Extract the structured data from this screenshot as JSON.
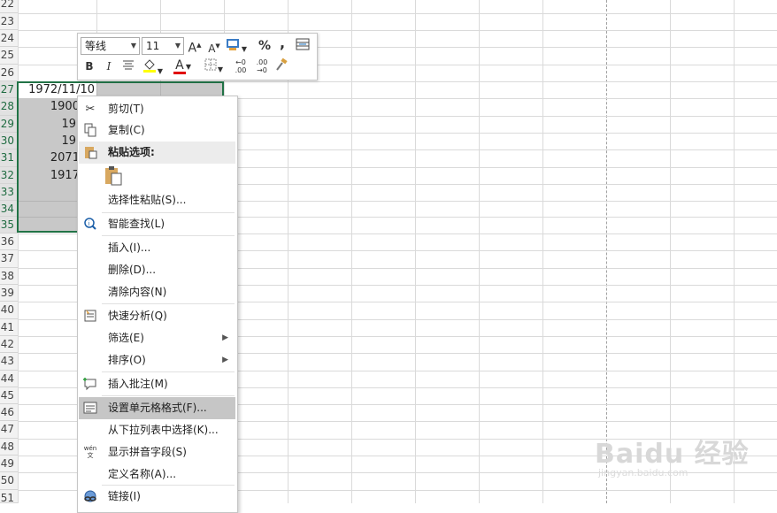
{
  "sheet": {
    "rows": [
      "22",
      "23",
      "24",
      "25",
      "26",
      "27",
      "28",
      "29",
      "30",
      "31",
      "32",
      "33",
      "34",
      "35",
      "36",
      "37",
      "38",
      "39",
      "40",
      "41",
      "42",
      "43",
      "44",
      "45",
      "46",
      "47",
      "48",
      "49",
      "50",
      "51"
    ],
    "cells": [
      "1972/11/10",
      "1900/1/",
      "1900/",
      "1900/",
      "2071/6/",
      "1917/2/"
    ]
  },
  "mini_toolbar": {
    "font_name": "等线",
    "font_size": "11",
    "grow_font": "A",
    "shrink_font": "A",
    "percent": "%",
    "comma": ",",
    "bold": "B",
    "italic": "I",
    "font_color_letter": "A",
    "dec_increase": "←0 .00",
    "dec_decrease": ".00 →0"
  },
  "context_menu": {
    "items": [
      {
        "label": "剪切(T)"
      },
      {
        "label": "复制(C)"
      },
      {
        "label": "粘贴选项:"
      },
      {
        "label": "选择性粘贴(S)..."
      },
      {
        "label": "智能查找(L)"
      },
      {
        "label": "插入(I)..."
      },
      {
        "label": "删除(D)..."
      },
      {
        "label": "清除内容(N)"
      },
      {
        "label": "快速分析(Q)"
      },
      {
        "label": "筛选(E)"
      },
      {
        "label": "排序(O)"
      },
      {
        "label": "插入批注(M)"
      },
      {
        "label": "设置单元格格式(F)..."
      },
      {
        "label": "从下拉列表中选择(K)..."
      },
      {
        "label": "显示拼音字段(S)"
      },
      {
        "label": "定义名称(A)..."
      },
      {
        "label": "链接(I)"
      }
    ],
    "pinyin_icon_text": "wén 文"
  },
  "watermark": {
    "brand": "Baidu 经验",
    "url": "jingyan.baidu.com"
  }
}
